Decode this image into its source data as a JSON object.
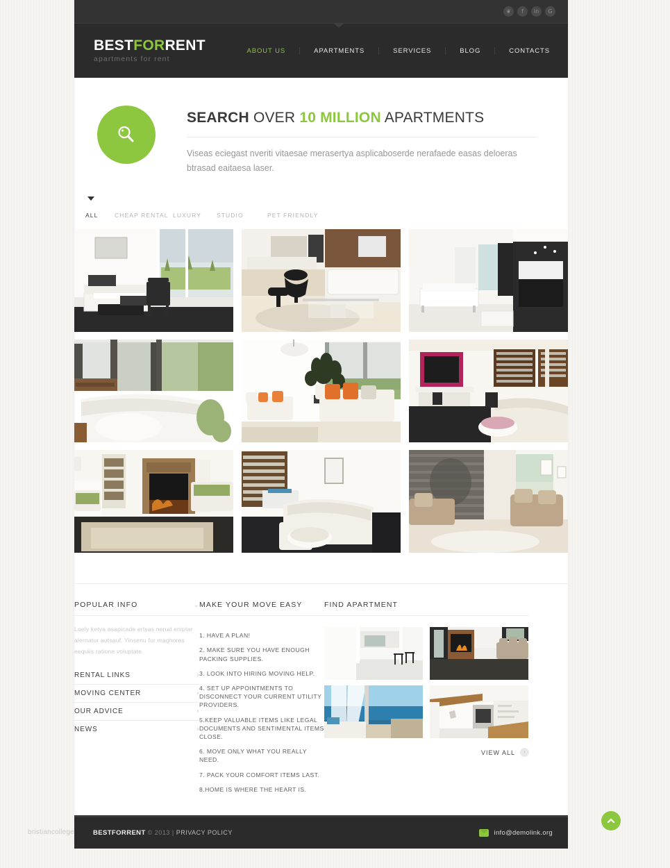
{
  "colors": {
    "accent_green": "#8dc63f",
    "header_dark": "#2b2b2b",
    "page_bg": "#f5f4f1",
    "sheet": "#ffffff",
    "muted_text": "#969696"
  },
  "topbar": {
    "social": [
      {
        "name": "twitter-icon",
        "glyph": "❦"
      },
      {
        "name": "facebook-icon",
        "glyph": "f"
      },
      {
        "name": "linkedin-icon",
        "glyph": "in"
      },
      {
        "name": "googleplus-icon",
        "glyph": "G"
      }
    ]
  },
  "header": {
    "logo": {
      "part1": "BEST",
      "part2": "FOR",
      "part3": "RENT",
      "tagline": "apartments for rent"
    },
    "nav": [
      {
        "label": "ABOUT US",
        "active": true
      },
      {
        "label": "APARTMENTS",
        "active": false
      },
      {
        "label": "SERVICES",
        "active": false
      },
      {
        "label": "BLOG",
        "active": false
      },
      {
        "label": "CONTACTS",
        "active": false
      }
    ]
  },
  "hero": {
    "badge_icon": "search-icon",
    "title_part1": "SEARCH",
    "title_part2": "OVER",
    "title_accent": "10 MILLION",
    "title_part3": "APARTMENTS",
    "subtitle": "Viseas eciegast nveriti vitaesae merasertya asplicaboserde nerafaede easas deloeras btrasad eaitaesa laser."
  },
  "filters": [
    {
      "label": "ALL",
      "active": true
    },
    {
      "label": "CHEAP RENTAL",
      "active": false
    },
    {
      "label": "LUXURY",
      "active": false
    },
    {
      "label": "STUDIO",
      "active": false
    },
    {
      "label": "PET FRIENDLY",
      "active": false
    }
  ],
  "gallery": [
    {
      "alt": "white-sofa-black-armchair-living-room"
    },
    {
      "alt": "modern-kitchen-with-lounge-chair"
    },
    {
      "alt": "white-minimal-living-room-with-kitchen"
    },
    {
      "alt": "bright-bedroom-with-garden-view"
    },
    {
      "alt": "white-sofa-with-orange-cushions"
    },
    {
      "alt": "living-room-with-tv-and-round-table"
    },
    {
      "alt": "library-living-room-with-fireplace"
    },
    {
      "alt": "cream-sectional-sofa-with-oval-table"
    },
    {
      "alt": "brick-wall-lounge-with-armchairs"
    }
  ],
  "footer": {
    "popular_info": {
      "title": "POPULAR INFO",
      "chevron": "⌄",
      "body": "Loely ketya asapicade ertyas nerud eniptar alernatur autsauf. Yinsenu fur maghores eequiis ratione voluptate.",
      "accordion": [
        {
          "label": "RENTAL LINKS",
          "chevron": "›"
        },
        {
          "label": "MOVING CENTER",
          "chevron": "›"
        },
        {
          "label": "OUR ADVICE",
          "chevron": "›"
        },
        {
          "label": "NEWS",
          "chevron": "›"
        }
      ]
    },
    "move_easy": {
      "title": "MAKE YOUR MOVE EASY",
      "items": [
        "1. HAVE A PLAN!",
        "2. MAKE SURE YOU HAVE ENOUGH PACKING SUPPLIES.",
        "3. LOOK INTO HIRING MOVING HELP.",
        "4. SET UP APPOINTMENTS TO DISCONNECT YOUR CURRENT UTILITY PROVIDERS.",
        "5.KEEP VALUABLE ITEMS LIKE LEGAL DOCUMENTS AND SENTIMENTAL ITEMS CLOSE.",
        "6. MOVE ONLY WHAT YOU REALLY NEED.",
        "7. PACK YOUR COMFORT ITEMS LAST.",
        "8.HOME IS WHERE THE HEART IS."
      ]
    },
    "find_apartment": {
      "title": "FIND APARTMENT",
      "thumbs": [
        {
          "alt": "white-kitchen-with-bar-stools"
        },
        {
          "alt": "copper-fireplace-with-sofa"
        },
        {
          "alt": "sea-view-window-balcony"
        },
        {
          "alt": "wood-and-white-kitchen-with-oven"
        }
      ],
      "view_all": "VIEW ALL",
      "view_all_chevron": "›"
    }
  },
  "bottombar": {
    "brand": "BESTFORRENT",
    "copyright": "© 2013",
    "separator": "|",
    "privacy": "PRIVACY POLICY",
    "mail_icon": "envelope-icon",
    "email": "info@demolink.org"
  },
  "scroll_top": {
    "icon": "chevron-up-icon"
  },
  "watermark": "bristiancollege.com"
}
